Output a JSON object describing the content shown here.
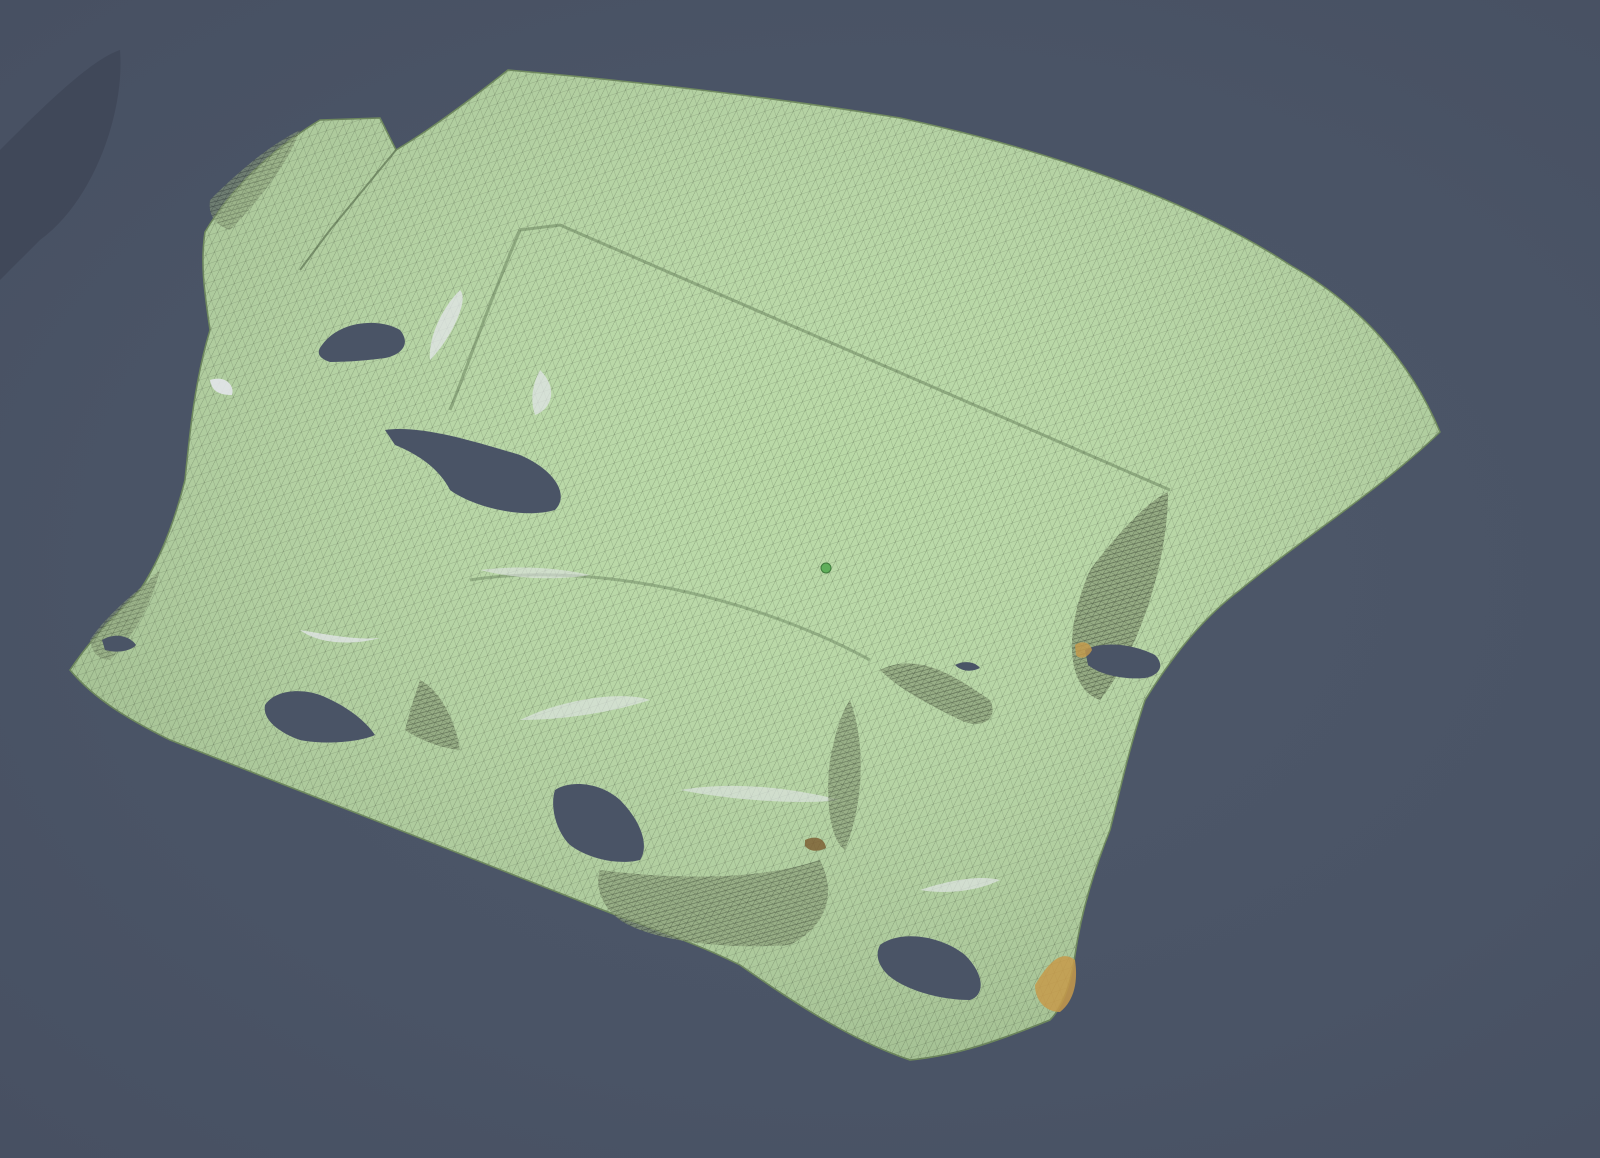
{
  "viewport": {
    "background_color": "#4a5466",
    "mesh_fill_color": "#b9d9a6",
    "mesh_wire_color": "#2e3a2a",
    "highlight_color": "#e3e6ea",
    "defect_color": "#c79a4a",
    "shadow_color": "#3f4757",
    "selected_vertex_color": "#5fae5a"
  }
}
